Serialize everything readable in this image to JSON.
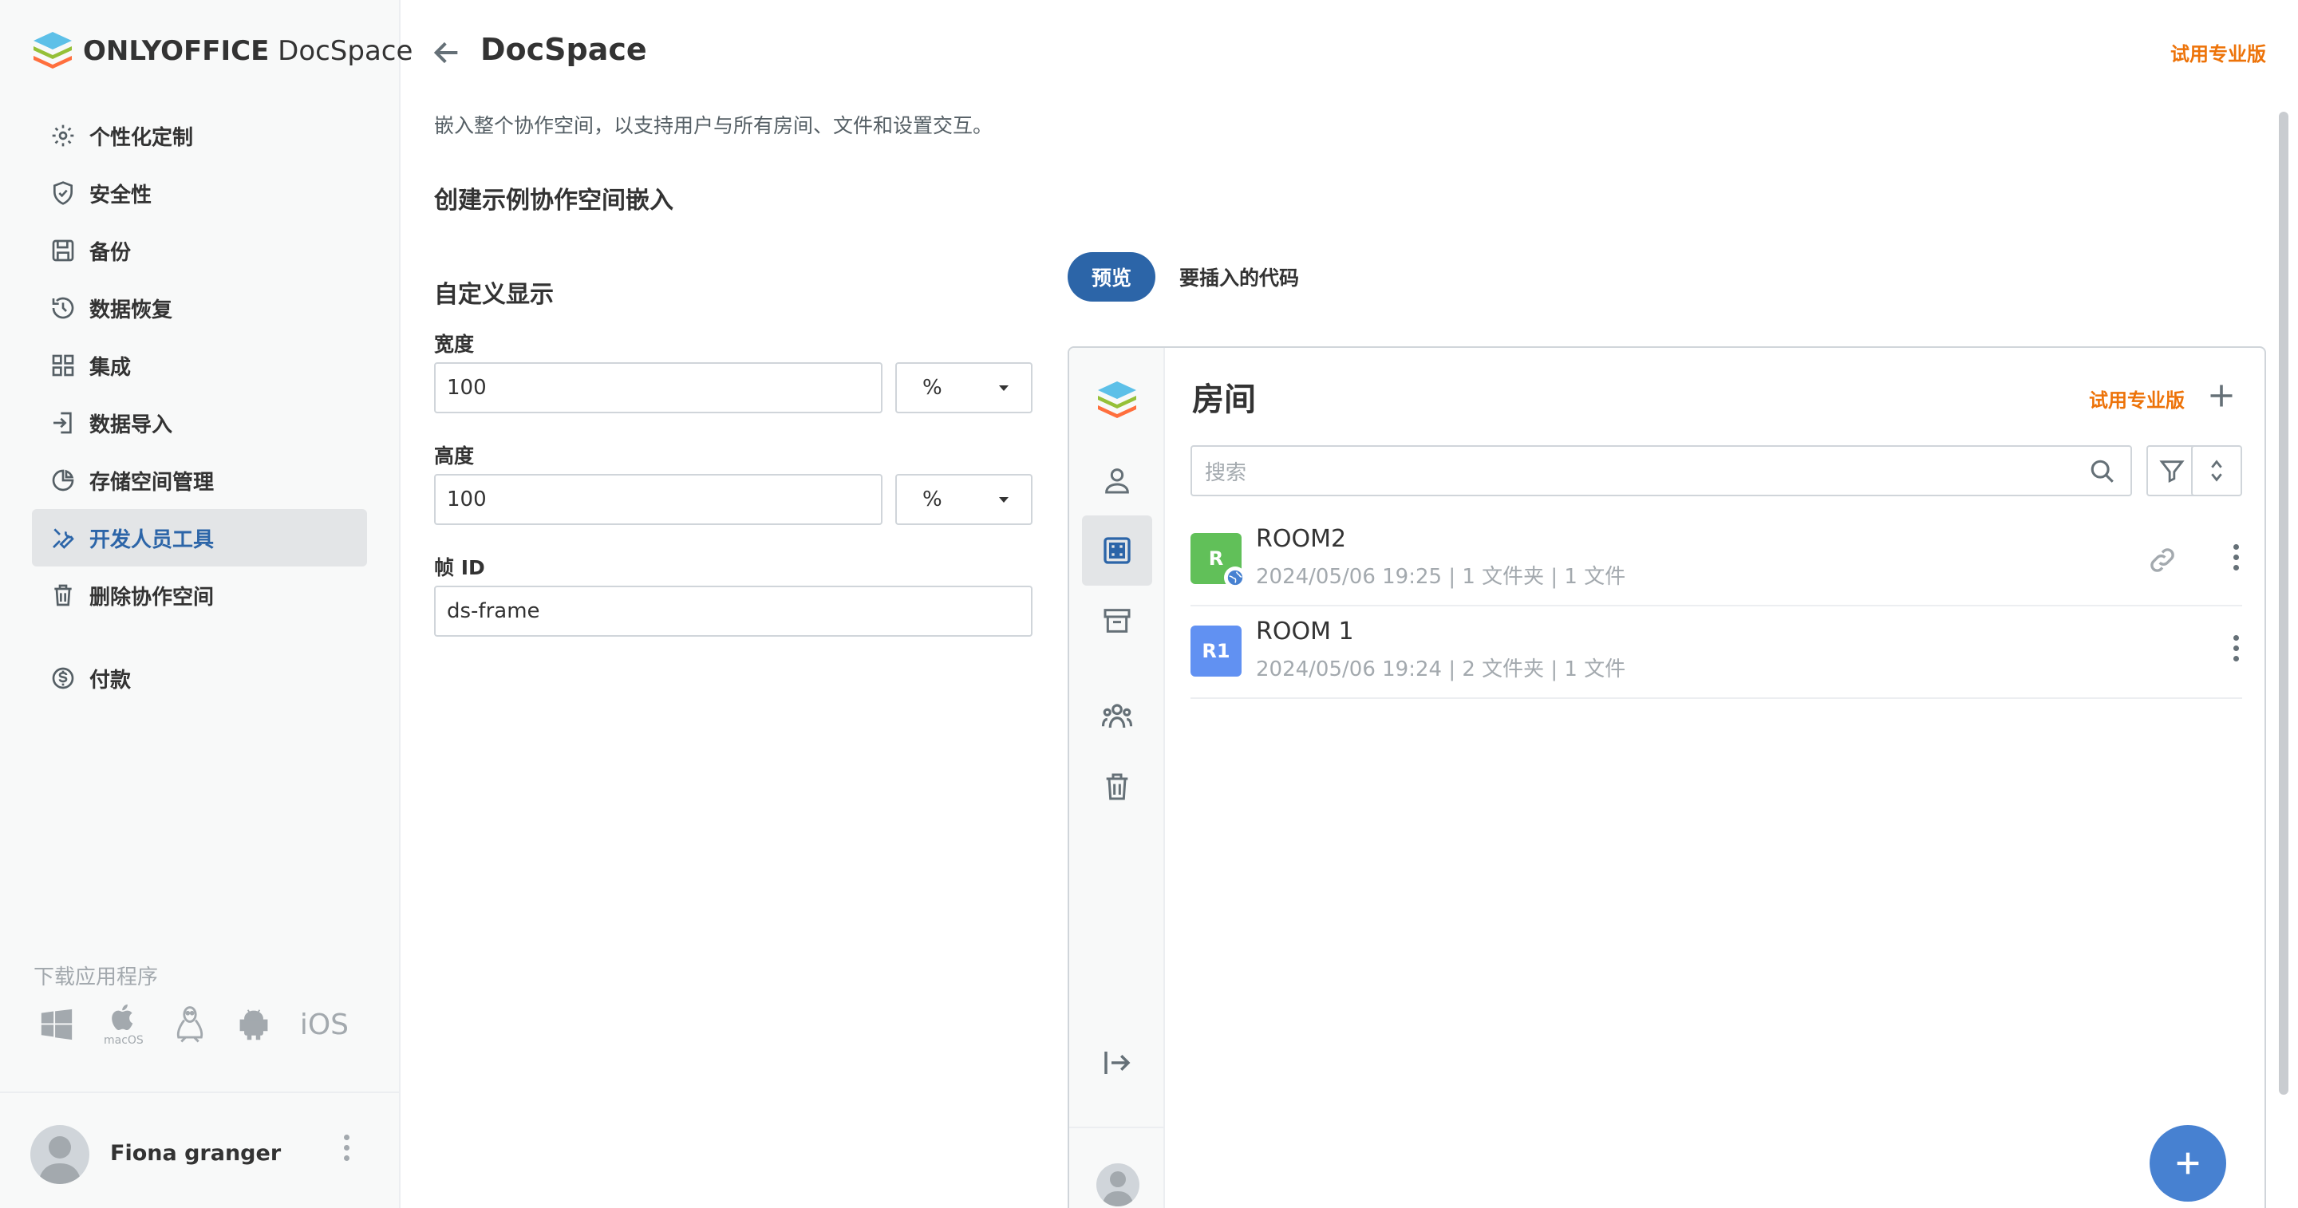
{
  "app": {
    "brand_bold": "ONLYOFFICE",
    "brand_light": " DocSpace"
  },
  "sidebar": {
    "items": [
      {
        "label": "个性化定制",
        "icon": "gear-icon"
      },
      {
        "label": "安全性",
        "icon": "shield-icon"
      },
      {
        "label": "备份",
        "icon": "save-icon"
      },
      {
        "label": "数据恢复",
        "icon": "history-icon"
      },
      {
        "label": "集成",
        "icon": "grid-icon"
      },
      {
        "label": "数据导入",
        "icon": "import-icon"
      },
      {
        "label": "存储空间管理",
        "icon": "pie-chart-icon"
      },
      {
        "label": "开发人员工具",
        "icon": "tools-icon",
        "active": true
      },
      {
        "label": "删除协作空间",
        "icon": "trash-icon"
      },
      {
        "label": "付款",
        "icon": "dollar-icon"
      }
    ],
    "download_title": "下载应用程序",
    "apps": {
      "mac_label": "macOS",
      "ios_label": "iOS"
    }
  },
  "profile": {
    "name": "Fiona granger"
  },
  "header": {
    "title": "DocSpace",
    "try_pro": "试用专业版"
  },
  "main": {
    "description": "嵌入整个协作空间，以支持用户与所有房间、文件和设置交互。",
    "section_title": "创建示例协作空间嵌入",
    "custom_title": "自定义显示",
    "width_label": "宽度",
    "width_value": "100",
    "width_unit": "%",
    "height_label": "高度",
    "height_value": "100",
    "height_unit": "%",
    "frame_id_label": "帧 ID",
    "frame_id_value": "ds-frame"
  },
  "tabs": {
    "preview": "预览",
    "code": "要插入的代码"
  },
  "preview": {
    "title": "房间",
    "try_pro": "试用专业版",
    "search_placeholder": "搜索",
    "rooms": [
      {
        "badge": "R",
        "name": "ROOM2",
        "meta": "2024/05/06 19:25 | 1 文件夹 | 1 文件",
        "color": "#61c059"
      },
      {
        "badge": "R1",
        "name": "ROOM 1",
        "meta": "2024/05/06 19:24 | 2 文件夹 | 1 文件",
        "color": "#6191f2"
      }
    ]
  },
  "colors": {
    "accent": "#2c65a8",
    "pro": "#ed7309",
    "fab": "#4781d1"
  }
}
